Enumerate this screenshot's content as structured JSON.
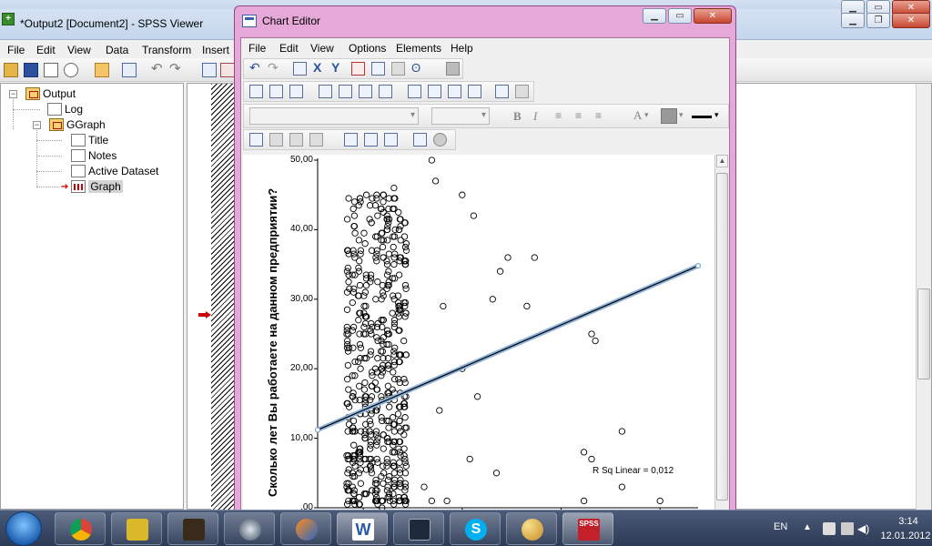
{
  "viewer": {
    "title": "*Output2 [Document2] - SPSS Viewer",
    "menu": [
      "File",
      "Edit",
      "View",
      "Data",
      "Transform",
      "Insert"
    ],
    "outline": {
      "root": "Output",
      "log": "Log",
      "ggraph": "GGraph",
      "children": [
        "Title",
        "Notes",
        "Active Dataset",
        "Graph"
      ]
    }
  },
  "editor": {
    "title": "Chart Editor",
    "menu": [
      "File",
      "Edit",
      "View",
      "Options",
      "Elements",
      "Help"
    ],
    "font_bold": "B",
    "font_italic": "I",
    "text_style": "A"
  },
  "chart_data": {
    "type": "scatter",
    "ylabel": "Сколько лет Вы работаете на данном предприятии?",
    "ylim": [
      0,
      50
    ],
    "yticks": [
      "50,00",
      "40,00",
      "30,00",
      "20,00",
      "10,00",
      ",00"
    ],
    "annotation": "R Sq Linear = 0,012",
    "fit_line": {
      "y_at_left": 11.2,
      "y_at_right": 34.8
    },
    "outliers": [
      {
        "x": 0.3,
        "y": 50
      },
      {
        "x": 0.31,
        "y": 47
      },
      {
        "x": 0.38,
        "y": 45
      },
      {
        "x": 0.41,
        "y": 42
      },
      {
        "x": 0.5,
        "y": 36
      },
      {
        "x": 0.48,
        "y": 34
      },
      {
        "x": 0.33,
        "y": 29
      },
      {
        "x": 0.55,
        "y": 29
      },
      {
        "x": 0.46,
        "y": 30
      },
      {
        "x": 0.72,
        "y": 25
      },
      {
        "x": 0.73,
        "y": 24
      },
      {
        "x": 0.38,
        "y": 20
      },
      {
        "x": 0.42,
        "y": 16
      },
      {
        "x": 0.32,
        "y": 14
      },
      {
        "x": 0.8,
        "y": 11
      },
      {
        "x": 0.7,
        "y": 8
      },
      {
        "x": 0.72,
        "y": 7
      },
      {
        "x": 0.4,
        "y": 7
      },
      {
        "x": 0.47,
        "y": 5
      },
      {
        "x": 0.8,
        "y": 3
      },
      {
        "x": 0.7,
        "y": 1
      },
      {
        "x": 0.9,
        "y": 1
      },
      {
        "x": 0.28,
        "y": 3
      },
      {
        "x": 0.3,
        "y": 1
      },
      {
        "x": 0.34,
        "y": 1
      },
      {
        "x": 0.19,
        "y": 1
      },
      {
        "x": 0.57,
        "y": 36
      }
    ]
  },
  "taskbar": {
    "language": "EN",
    "time": "3:14",
    "date": "12.01.2012",
    "spss_label": "SPSS"
  }
}
